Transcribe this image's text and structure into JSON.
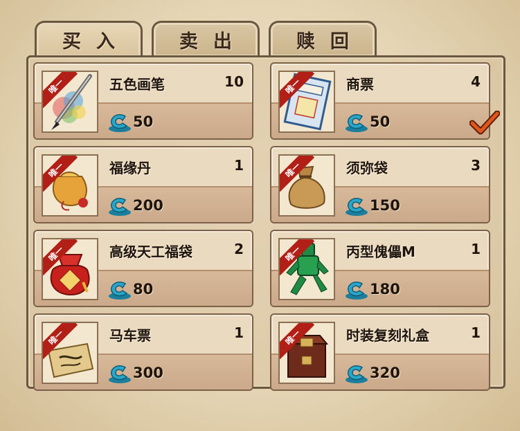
{
  "tabs": [
    {
      "label": "买入",
      "active": true
    },
    {
      "label": "卖出",
      "active": false
    },
    {
      "label": "赎回",
      "active": false
    }
  ],
  "badge_text": "唯一",
  "items": [
    {
      "name": "五色画笔",
      "qty": "10",
      "price": "50",
      "icon": "brush-icon"
    },
    {
      "name": "商票",
      "qty": "4",
      "price": "50",
      "icon": "trade-ticket-icon",
      "selected": true
    },
    {
      "name": "福缘丹",
      "qty": "1",
      "price": "200",
      "icon": "fortune-pill-pouch-icon"
    },
    {
      "name": "须弥袋",
      "qty": "3",
      "price": "150",
      "icon": "cloth-sack-icon"
    },
    {
      "name": "高级天工福袋",
      "qty": "2",
      "price": "80",
      "icon": "red-lucky-bag-icon"
    },
    {
      "name": "丙型傀儡M",
      "qty": "1",
      "price": "180",
      "icon": "jade-puppet-icon"
    },
    {
      "name": "马车票",
      "qty": "1",
      "price": "300",
      "icon": "carriage-ticket-icon"
    },
    {
      "name": "时装复刻礼盒",
      "qty": "1",
      "price": "320",
      "icon": "gift-chest-icon"
    }
  ],
  "colors": {
    "ribbon": "#b21f16",
    "coin": "#2aa6c9",
    "check": "#d9480f"
  }
}
